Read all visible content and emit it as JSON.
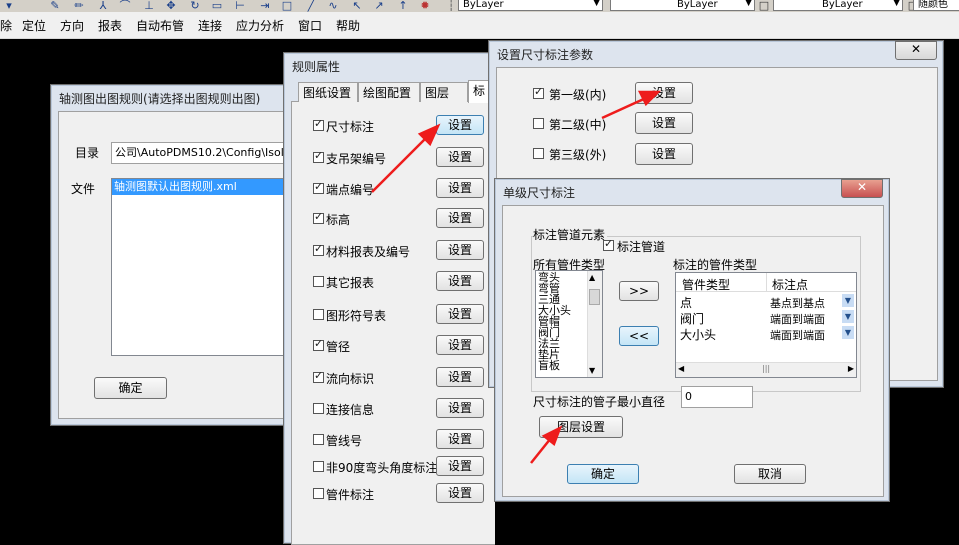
{
  "toolbar": {
    "layer_combo_1": "ByLayer",
    "layer_combo_2": "ByLayer",
    "layer_combo_3": "ByLayer",
    "color_combo": "随颜色"
  },
  "menubar": {
    "items": [
      "除",
      "定位",
      "方向",
      "报表",
      "自动布管",
      "连接",
      "应力分析",
      "窗口",
      "帮助"
    ]
  },
  "axis_window": {
    "title": "轴测图出图规则(请选择出图规则出图)",
    "dir_label": "目录",
    "dir_value": "公司\\AutoPDMS10.2\\Config\\Isol",
    "file_label": "文件",
    "file_selected": "轴测图默认出图规则.xml",
    "ok_label": "确定"
  },
  "rule_window": {
    "title": "规则属性",
    "tabs": [
      "图纸设置",
      "绘图配置",
      "图层",
      "标"
    ],
    "rows": [
      {
        "label": "尺寸标注",
        "checked": true
      },
      {
        "label": "支吊架编号",
        "checked": true
      },
      {
        "label": "端点编号",
        "checked": true
      },
      {
        "label": "标高",
        "checked": true
      },
      {
        "label": "材料报表及编号",
        "checked": true
      },
      {
        "label": "其它报表",
        "checked": false
      },
      {
        "label": "图形符号表",
        "checked": false
      },
      {
        "label": "管径",
        "checked": true
      },
      {
        "label": "流向标识",
        "checked": true
      },
      {
        "label": "连接信息",
        "checked": false
      },
      {
        "label": "管线号",
        "checked": false
      },
      {
        "label": "非90度弯头角度标注",
        "checked": false
      },
      {
        "label": "管件标注",
        "checked": false
      }
    ],
    "setting_label": "设置"
  },
  "dim_window": {
    "title": "设置尺寸标注参数",
    "close_label": "✕",
    "levels": [
      {
        "label": "第一级(内)",
        "checked": true
      },
      {
        "label": "第二级(中)",
        "checked": false
      },
      {
        "label": "第三级(外)",
        "checked": false
      }
    ],
    "setting_label": "设置"
  },
  "single_window": {
    "title": "单级尺寸标注",
    "close_label": "✕",
    "group_label": "标注管道元素",
    "mark_pipe_label": "标注管道",
    "mark_pipe_checked": true,
    "all_types_label": "所有管件类型",
    "all_types": [
      "弯头",
      "弯管",
      "三通",
      "大小头",
      "管帽",
      "阀门",
      "法兰",
      "垫片",
      "盲板"
    ],
    "add_label": ">>",
    "remove_label": "<<",
    "marked_types_label": "标注的管件类型",
    "table_headers": [
      "管件类型",
      "标注点"
    ],
    "table_rows": [
      {
        "type": "点",
        "point": "基点到基点"
      },
      {
        "type": "阀门",
        "point": "端面到端面"
      },
      {
        "type": "大小头",
        "point": "端面到端面"
      }
    ],
    "min_diam_label": "尺寸标注的管子最小直径",
    "min_diam_value": "0",
    "layer_setting_label": "图层设置",
    "ok_label": "确定",
    "cancel_label": "取消"
  }
}
